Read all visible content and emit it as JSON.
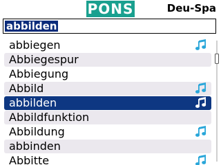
{
  "header": {
    "logo_text": "PONS",
    "language_pair": "Deu-Spa"
  },
  "search": {
    "value": "abbilden"
  },
  "list": {
    "items": [
      {
        "label": "abbiegen",
        "audio": true
      },
      {
        "label": "Abbiegespur",
        "audio": false
      },
      {
        "label": "Abbiegung",
        "audio": false
      },
      {
        "label": "Abbild",
        "audio": true
      },
      {
        "label": "abbilden",
        "audio": true,
        "selected": true
      },
      {
        "label": "Abbildfunktion",
        "audio": false
      },
      {
        "label": "Abbildung",
        "audio": true
      },
      {
        "label": "abbinden",
        "audio": false
      },
      {
        "label": "Abbitte",
        "audio": true
      }
    ]
  },
  "scrollbar": {
    "position": 0.12
  },
  "colors": {
    "logo_bg": "#1aa08f",
    "selection": "#0e3782",
    "row_alt": "#ebe8ee",
    "audio_icon": "#29a6d9"
  }
}
